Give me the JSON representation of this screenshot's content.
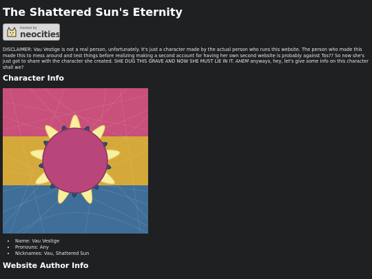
{
  "page": {
    "title": "The Shattered Sun's Eternity"
  },
  "badge": {
    "small_text": "hosted by",
    "brand_text": "neocities",
    "icon": "neocities-cat-icon"
  },
  "disclaimer": {
    "lead": "DISCLAIMER: Vau Vestige is not a real person, unfortunately. It's just a character made by the actual person who runs this website. The person who made this made this to mess around and test things before realizing making a second account for having her own second website is probably against Tos?? So now she's just got to share with the character she created. SHE DUG THIS GRAVE AND NOW SHE MUST LIE IN IT. ",
    "emphasis": "AHEM",
    "tail": " anyways, hey, let's give some info on this character shall we?"
  },
  "character_info": {
    "heading": "Character Info",
    "image": {
      "subject": "sun-emblem-icon",
      "stripe_colors": [
        "#c8507a",
        "#d4a93a",
        "#3f6f99"
      ]
    },
    "items": [
      "Name: Vau Vestige",
      "Pronouns: Any",
      "Nicknames: Vau, Shattered Sun"
    ]
  },
  "author_info": {
    "heading": "Website Author Info"
  }
}
